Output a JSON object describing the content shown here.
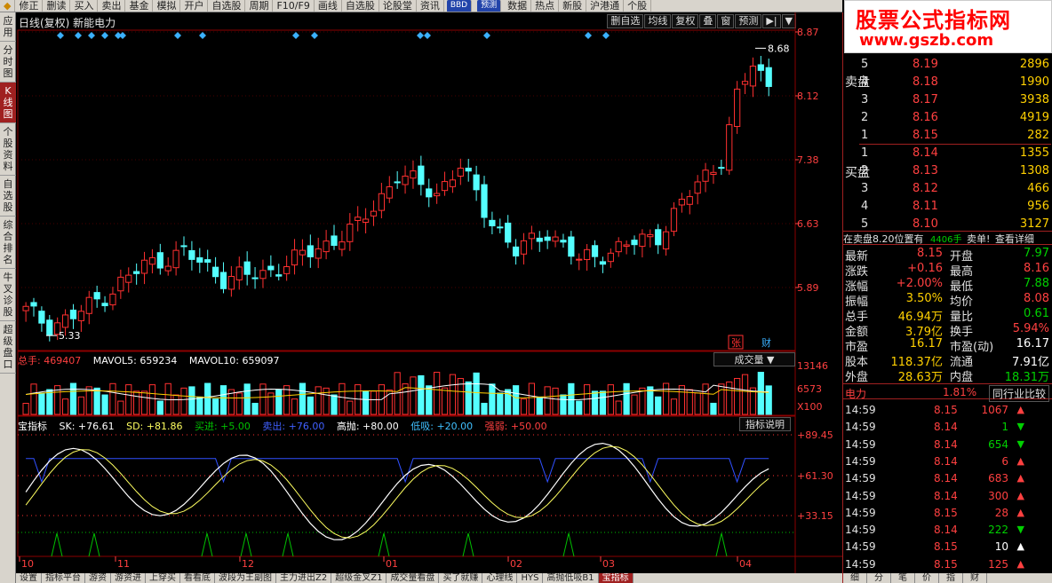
{
  "toolbar": [
    "◆",
    "修正",
    "删读",
    "买入",
    "卖出",
    "基金",
    "模拟",
    "开户",
    "自选股",
    "周期",
    "F10/F9",
    "画线",
    "自选股",
    "论股堂",
    "资讯",
    "BBD",
    "预测",
    "数据",
    "热点",
    "新股",
    "沪港通",
    "个股"
  ],
  "left_tabs": [
    {
      "label": "应用",
      "active": false
    },
    {
      "label": "分时图",
      "active": false
    },
    {
      "label": "K线图",
      "active": true
    },
    {
      "label": "个股资料",
      "active": false
    },
    {
      "label": "自选股",
      "active": false
    },
    {
      "label": "综合排名",
      "active": false
    },
    {
      "label": "牛叉诊股",
      "active": false
    },
    {
      "label": "超级盘口",
      "active": false
    }
  ],
  "header": {
    "title": "日线(复权)  新能电力",
    "tools": [
      "删自选",
      "均线",
      "复权",
      "叠",
      "窗",
      "预测",
      "▶|",
      "▼"
    ]
  },
  "price_axis": [
    "8.87",
    "8.12",
    "7.38",
    "6.63",
    "5.89"
  ],
  "annotations": {
    "high": "8.68",
    "low": "5.33",
    "zhang": "张",
    "cai": "财"
  },
  "volume": {
    "label_total": "总手: 469407",
    "label_ma5": "MAVOL5: 659234",
    "label_ma10": "MAVOL10: 659097",
    "dropdown": "成交量 ▼",
    "axis": [
      "13146",
      "6573",
      "X100"
    ]
  },
  "indicator": {
    "name": "宝指标",
    "sk": "SK: +76.61",
    "sd": "SD: +81.86",
    "buy": "买进: +5.00",
    "sell": "卖出: +76.00",
    "high": "高抛: +80.00",
    "low": "低吸: +20.00",
    "strong": "强弱: +50.00",
    "help_button": "指标说明",
    "axis": [
      "+89.45",
      "+61.30",
      "+33.15"
    ]
  },
  "x_axis": [
    "10",
    "11",
    "12",
    "01",
    "02",
    "03",
    "04"
  ],
  "bottom_tabs": [
    {
      "label": "设置",
      "active": false
    },
    {
      "label": "指标平台",
      "active": false
    },
    {
      "label": "游资",
      "active": false
    },
    {
      "label": "游资进",
      "active": false
    },
    {
      "label": "上穿买",
      "active": false
    },
    {
      "label": "看看底",
      "active": false
    },
    {
      "label": "波段为王副图",
      "active": false
    },
    {
      "label": "主力进出Z2",
      "active": false
    },
    {
      "label": "超级金叉Z1",
      "active": false
    },
    {
      "label": "成交量看盘",
      "active": false
    },
    {
      "label": "买了就赚",
      "active": false
    },
    {
      "label": "心理线",
      "active": false
    },
    {
      "label": "HYS",
      "active": false
    },
    {
      "label": "高抛低吸B1",
      "active": false
    },
    {
      "label": "宝指标",
      "active": true
    }
  ],
  "watermark": {
    "line1": "股票公式指标网",
    "line2": "www.gszb.com"
  },
  "orderbook": {
    "sell_label": "卖盘",
    "buy_label": "买盘",
    "sell": [
      {
        "lvl": "5",
        "price": "8.19",
        "vol": "2896"
      },
      {
        "lvl": "4",
        "price": "8.18",
        "vol": "1990"
      },
      {
        "lvl": "3",
        "price": "8.17",
        "vol": "3938"
      },
      {
        "lvl": "2",
        "price": "8.16",
        "vol": "4919"
      },
      {
        "lvl": "1",
        "price": "8.15",
        "vol": "282"
      }
    ],
    "buy": [
      {
        "lvl": "1",
        "price": "8.14",
        "vol": "1355"
      },
      {
        "lvl": "2",
        "price": "8.13",
        "vol": "1308"
      },
      {
        "lvl": "3",
        "price": "8.12",
        "vol": "466"
      },
      {
        "lvl": "4",
        "price": "8.11",
        "vol": "956"
      },
      {
        "lvl": "5",
        "price": "8.10",
        "vol": "3127"
      }
    ],
    "notice_a": "在卖盘8.20位置有",
    "notice_b": "4406手",
    "notice_c": "卖单!",
    "notice_link": "查看详细"
  },
  "stats": [
    {
      "l1": "最新",
      "v1": "8.15",
      "l2": "开盘",
      "v2": "7.97"
    },
    {
      "l1": "涨跌",
      "v1": "+0.16",
      "l2": "最高",
      "v2": "8.16"
    },
    {
      "l1": "涨幅",
      "v1": "+2.00%",
      "l2": "最低",
      "v2": "7.88"
    },
    {
      "l1": "振幅",
      "v1": "3.50%",
      "l2": "均价",
      "v2": "8.08"
    },
    {
      "l1": "总手",
      "v1": "46.94万",
      "l2": "量比",
      "v2": "0.61"
    },
    {
      "l1": "金额",
      "v1": "3.79亿",
      "l2": "换手",
      "v2": "5.94%"
    },
    {
      "l1": "市盈",
      "v1": "16.17",
      "l2": "市盈(动)",
      "v2": "16.17"
    },
    {
      "l1": "股本",
      "v1": "118.37亿",
      "l2": "流通",
      "v2": "7.91亿"
    },
    {
      "l1": "外盘",
      "v1": "28.63万",
      "l2": "内盘",
      "v2": "18.31万"
    }
  ],
  "sector": {
    "name": "电力",
    "change": "1.81%",
    "button": "同行业比较"
  },
  "trades": [
    {
      "t": "14:59",
      "p": "8.15",
      "v": "1067",
      "dir": "up"
    },
    {
      "t": "14:59",
      "p": "8.14",
      "v": "1",
      "dir": "down"
    },
    {
      "t": "14:59",
      "p": "8.14",
      "v": "654",
      "dir": "down"
    },
    {
      "t": "14:59",
      "p": "8.14",
      "v": "6",
      "dir": "up"
    },
    {
      "t": "14:59",
      "p": "8.14",
      "v": "683",
      "dir": "up"
    },
    {
      "t": "14:59",
      "p": "8.14",
      "v": "300",
      "dir": "up"
    },
    {
      "t": "14:59",
      "p": "8.15",
      "v": "28",
      "dir": "up"
    },
    {
      "t": "14:59",
      "p": "8.14",
      "v": "222",
      "dir": "down"
    },
    {
      "t": "14:59",
      "p": "8.15",
      "v": "10",
      "dir": "neutral"
    },
    {
      "t": "14:59",
      "p": "8.15",
      "v": "125",
      "dir": "up"
    }
  ],
  "right_bottom_tabs": [
    "细",
    "分",
    "笔",
    "价",
    "指",
    "财"
  ],
  "colors": {
    "up": "#ff3030",
    "down": "#54ffff",
    "ma5": "#ffffff",
    "ma10": "#ffd000",
    "bg": "#000000",
    "grid": "#8b0000"
  }
}
